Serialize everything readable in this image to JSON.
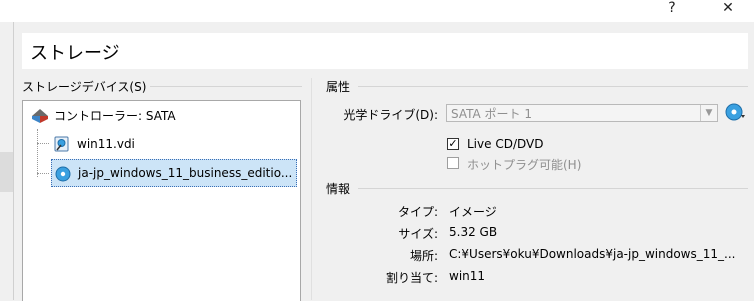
{
  "window": {
    "help_glyph": "?",
    "close_glyph": "✕"
  },
  "header": {
    "title": "ストレージ"
  },
  "storage_devices": {
    "label": "ストレージデバイス(S)",
    "controller": "コントローラー: SATA",
    "items": [
      {
        "name": "win11.vdi",
        "icon": "hard-disk-icon"
      },
      {
        "name": "ja-jp_windows_11_business_editio...",
        "icon": "optical-disc-icon",
        "selected": true
      }
    ]
  },
  "attributes": {
    "label": "属性",
    "optical_drive_label": "光学ドライブ(D):",
    "optical_drive_value": "SATA ポート 1",
    "live_cd_label": "Live CD/DVD",
    "live_cd_checked": true,
    "hotplug_label": "ホットプラグ可能(H)",
    "hotplug_checked": false
  },
  "info": {
    "label": "情報",
    "type_label": "タイプ:",
    "type_value": "イメージ",
    "size_label": "サイズ:",
    "size_value": "5.32 GB",
    "location_label": "場所:",
    "location_value": "C:¥Users¥oku¥Downloads¥ja-jp_windows_11_...",
    "attached_label": "割り当て:",
    "attached_value": "win11"
  },
  "colors": {
    "selection": "#cce4f7",
    "disc_blue": "#3aa0e0",
    "disabled_text": "#8f8f8f"
  }
}
